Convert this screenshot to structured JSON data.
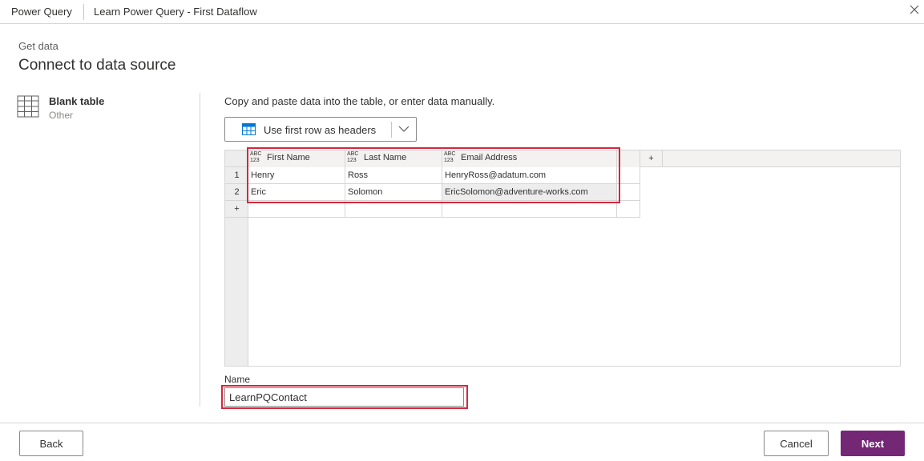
{
  "titlebar": {
    "app": "Power Query",
    "document": "Learn Power Query - First Dataflow"
  },
  "header": {
    "breadcrumb": "Get data",
    "title": "Connect to data source"
  },
  "source": {
    "name": "Blank table",
    "category": "Other"
  },
  "main": {
    "instruction": "Copy and paste data into the table, or enter data manually.",
    "headers_button": "Use first row as headers"
  },
  "table": {
    "type_top": "ABC",
    "type_bottom": "123",
    "columns": [
      "First Name",
      "Last Name",
      "Email Address"
    ],
    "add_column": "+",
    "add_row": "+",
    "row_numbers": [
      "1",
      "2"
    ],
    "rows": [
      [
        "Henry",
        "Ross",
        "HenryRoss@adatum.com"
      ],
      [
        "Eric",
        "Solomon",
        "EricSolomon@adventure-works.com"
      ]
    ]
  },
  "name_field": {
    "label": "Name",
    "value": "LearnPQContact"
  },
  "footer": {
    "back": "Back",
    "cancel": "Cancel",
    "next": "Next"
  },
  "colors": {
    "accent": "#742774",
    "highlight": "#d7263d"
  }
}
